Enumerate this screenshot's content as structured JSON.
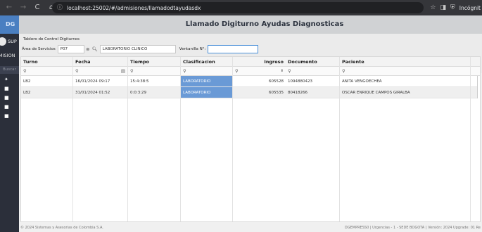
{
  "browser": {
    "url": "localhost:25002/#/admisiones/llamadodtayudasdx",
    "incognito_label": "Incógnit"
  },
  "sidebar": {
    "logo": "DG",
    "user": "SUP",
    "section": "MISION",
    "search_placeholder": "Buscar"
  },
  "page": {
    "title": "Llamado Digiturno Ayudas Diagnosticas"
  },
  "panel": {
    "title": "Tablero de Control Digiturnos",
    "area_label": "Área de Servicios",
    "area_code": "P07",
    "area_name": "LABORATORIO CLINICO",
    "ventanilla_label": "Ventanilla N°:",
    "ventanilla_value": ""
  },
  "grid": {
    "columns": [
      "Turno",
      "Fecha",
      "Tiempo",
      "Clasificacion",
      "Ingreso",
      "Documento",
      "Paciente"
    ],
    "rows": [
      {
        "turno": "LB2",
        "fecha": "16/01/2024 09:17",
        "tiempo": "15:4:38:5",
        "clasificacion": "LABORATORIO",
        "ingreso": "605528",
        "documento": "1094880423",
        "paciente": "ANITA VENGOECHEA"
      },
      {
        "turno": "LB2",
        "fecha": "31/01/2024 01:52",
        "tiempo": "0:0:3:29",
        "clasificacion": "LABORATORIO",
        "ingreso": "605535",
        "documento": "80418266",
        "paciente": "OSCAR ENRIQUE CAMPOS GIRALBA"
      }
    ]
  },
  "footer": {
    "left": "© 2024 Sistemas y Asesorias de Colombia S.A.",
    "right": "DGEMPRESS0 | Urgencias - 1 - SEDE BOGOTA | Versión: 2024 Upgrade: 01 Re"
  },
  "colors": {
    "sidebar_bg": "#2b2f3a",
    "logo_bg": "#4a7fc1",
    "selected_cell": "#6a9ad6",
    "title_bar": "#d0d2d4"
  }
}
